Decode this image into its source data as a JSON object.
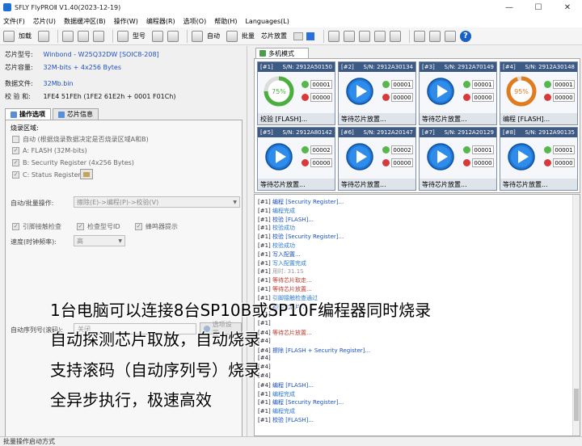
{
  "window": {
    "title": "SFLY FlyPROⅡ V1.40(2023-12-19)",
    "min": "—",
    "max": "☐",
    "close": "✕"
  },
  "menu": [
    "文件(F)",
    "芯片(U)",
    "数据缓冲区(B)",
    "操作(W)",
    "编程器(R)",
    "选项(O)",
    "帮助(H)",
    "Languages(L)"
  ],
  "toolbar": {
    "load": "加载",
    "model": "型号",
    "auto": "自动",
    "batch": "批量",
    "chip_place": "芯片放置"
  },
  "chip_info": {
    "chip_model_label": "芯片型号:",
    "chip_model": "Winbond - W25Q32DW  [SOIC8-208]",
    "chip_capacity_label": "芯片容量:",
    "chip_capacity": "32M-bits + 4x256 Bytes",
    "data_file_label": "数据文件:",
    "data_file": "32Mb.bin",
    "checksum_label": "校 验 和:",
    "checksum": "1FE4 51FEh (1FE2 61E2h + 0001 F01Ch)"
  },
  "tabs": {
    "options": "操作选项",
    "chip_info": "芯片信息"
  },
  "options": {
    "burn_area": "烧录区域:",
    "auto_area": "自动 (根据烧录数据决定是否烧录区域A和B)",
    "area_a": "A: FLASH (32M-bits)",
    "area_b": "B: Security Register (4x256 Bytes)",
    "area_c": "C: Status Register",
    "auto_batch_label": "自动/批量操作:",
    "auto_batch_value": "擦除(E)->编程(P)->校验(V)",
    "pin_check": "引脚接触检查",
    "check_id": "检查型号ID",
    "buzzer": "蜂鸣器提示",
    "speed_label": "速度(时钟频率):",
    "speed_value": "高",
    "serial_label": "自动序列号(滚码):",
    "serial_value": "关闭",
    "serial_btn": "选项设置"
  },
  "multimode": {
    "tab": "多机模式",
    "cards": [
      {
        "id": "[#1]",
        "sn": "S/N: 2912A50150",
        "state": "progress",
        "percent": 75,
        "percent_text": "75%",
        "ok": "00001",
        "bad": "00000",
        "status": "校验 [FLASH]...",
        "color": "#4cae3f"
      },
      {
        "id": "[#2]",
        "sn": "S/N: 2912A30134",
        "state": "play",
        "ok": "00001",
        "bad": "00000",
        "status": "等待芯片放置..."
      },
      {
        "id": "[#3]",
        "sn": "S/N: 2912A70149",
        "state": "play",
        "ok": "00001",
        "bad": "00000",
        "status": "等待芯片放置..."
      },
      {
        "id": "[#4]",
        "sn": "S/N: 2912A30148",
        "state": "progress",
        "percent": 95,
        "percent_text": "95%",
        "ok": "00001",
        "bad": "00000",
        "status": "编程 [FLASH]...",
        "color": "#e07b1e"
      },
      {
        "id": "[#5]",
        "sn": "S/N: 2912A80142",
        "state": "play",
        "ok": "00002",
        "bad": "00000",
        "status": "等待芯片放置..."
      },
      {
        "id": "[#6]",
        "sn": "S/N: 2912A20147",
        "state": "play",
        "ok": "00002",
        "bad": "00000",
        "status": "等待芯片放置..."
      },
      {
        "id": "[#7]",
        "sn": "S/N: 2912A20129",
        "state": "play",
        "ok": "00001",
        "bad": "00000",
        "status": "等待芯片放置..."
      },
      {
        "id": "[#8]",
        "sn": "S/N: 2912A90135",
        "state": "play",
        "ok": "00001",
        "bad": "00000",
        "status": "等待芯片放置..."
      }
    ]
  },
  "log": [
    {
      "tag": "[#1]",
      "text": "编程 [Security Register]...",
      "color": "#1a4fc0"
    },
    {
      "tag": "[#1]",
      "text": "编程完成",
      "color": "#2a7ad0"
    },
    {
      "tag": "[#1]",
      "text": "校验 [FLASH]...",
      "color": "#1a4fc0"
    },
    {
      "tag": "[#1]",
      "text": "校验成功",
      "color": "#2a7ad0"
    },
    {
      "tag": "[#1]",
      "text": "校验 [Security Register]...",
      "color": "#1a4fc0"
    },
    {
      "tag": "[#1]",
      "text": "校验成功",
      "color": "#2a7ad0"
    },
    {
      "tag": "[#1]",
      "text": "写入配置...",
      "color": "#1a4fc0"
    },
    {
      "tag": "[#1]",
      "text": "写入配置完成",
      "color": "#2a7ad0"
    },
    {
      "tag": "[#1]",
      "text": "用时: 31.1S",
      "color": "#999999"
    },
    {
      "tag": "[#1]",
      "text": "等待芯片取走...",
      "color": "#c0392b"
    },
    {
      "tag": "[#1]",
      "text": "等待芯片放置...",
      "color": "#c0392b"
    },
    {
      "tag": "[#1]",
      "text": "引脚接触检查通过",
      "color": "#2a7ad0"
    },
    {
      "tag": "[#1]",
      "text": "初始化芯片...",
      "color": "#1a4fc0"
    },
    {
      "tag": "[#1]",
      "text": "",
      "color": "#1a4fc0"
    },
    {
      "tag": "[#1]",
      "text": "",
      "color": "#1a4fc0"
    },
    {
      "tag": "[#4]",
      "text": "等待芯片放置...",
      "color": "#c0392b"
    },
    {
      "tag": "[#4]",
      "text": "",
      "color": "#2a7ad0"
    },
    {
      "tag": "[#4]",
      "text": "擦除 [FLASH + Security Register]...",
      "color": "#1a4fc0"
    },
    {
      "tag": "[#4]",
      "text": "",
      "color": "#2a7ad0"
    },
    {
      "tag": "[#4]",
      "text": "",
      "color": "#1a4fc0"
    },
    {
      "tag": "[#4]",
      "text": "",
      "color": "#2a7ad0"
    },
    {
      "tag": "[#4]",
      "text": "编程 [FLASH]...",
      "color": "#1a4fc0"
    },
    {
      "tag": "[#1]",
      "text": "编程完成",
      "color": "#2a7ad0"
    },
    {
      "tag": "[#1]",
      "text": "编程 [Security Register]...",
      "color": "#1a4fc0"
    },
    {
      "tag": "[#1]",
      "text": "编程完成",
      "color": "#2a7ad0"
    },
    {
      "tag": "[#1]",
      "text": "校验 [FLASH]...",
      "color": "#1a4fc0"
    }
  ],
  "overlay": [
    "1台电脑可以连接8台SP10B或SP10F编程器同时烧录",
    "自动探测芯片取放，自动烧录",
    "支持滚码（自动序列号）烧录",
    "全异步执行，极速高效"
  ],
  "status_bar": "批量操作启动方式"
}
